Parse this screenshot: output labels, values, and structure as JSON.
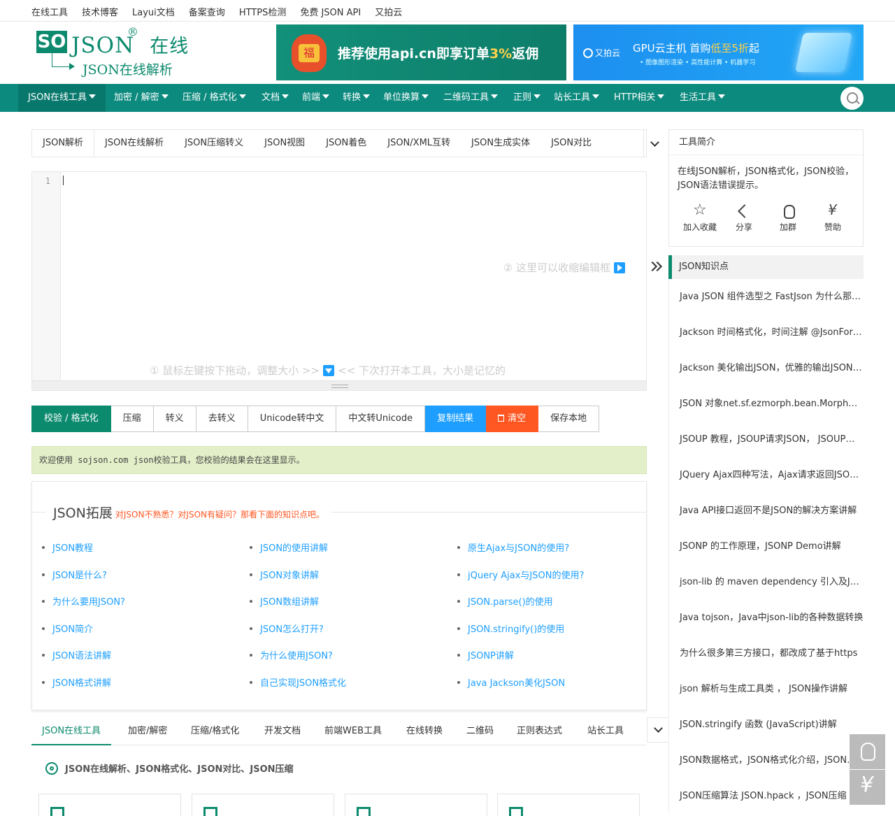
{
  "topbar": {
    "links": [
      "在线工具",
      "技术博客",
      "Layui文档",
      "备案查询",
      "HTTPS检测",
      "免费 JSON API",
      "又拍云"
    ]
  },
  "logo": {
    "so": "SO",
    "json": "JSON",
    "reg": "®",
    "zx": "在线",
    "sub": "JSON在线解析"
  },
  "ads": {
    "ad1": {
      "text_a": "推荐使用api.cn即享订单",
      "text_hl": "3%",
      "text_b": "返佣",
      "badge": "福"
    },
    "ad2": {
      "brand": "又拍云",
      "main_a": "GPU云主机 首购",
      "main_hl": "低至5折",
      "main_b": "起",
      "small": "• 图像图形渲染 • 高性能计算 • 机器学习"
    }
  },
  "nav": {
    "items": [
      "JSON在线工具",
      "加密 / 解密",
      "压缩 / 格式化",
      "文档",
      "前端",
      "转换",
      "单位换算",
      "二维码工具",
      "正则",
      "站长工具",
      "HTTP相关",
      "生活工具"
    ]
  },
  "tool_tabs": [
    "JSON解析",
    "JSON在线解析",
    "JSON压缩转义",
    "JSON视图",
    "JSON着色",
    "JSON/XML互转",
    "JSON生成实体",
    "JSON对比"
  ],
  "editor": {
    "line_number": "1",
    "hint_collapse": "② 这里可以收缩编辑框",
    "hint_resize_a": "① 鼠标左键按下拖动，调整大小 >>",
    "hint_resize_b": "<< 下次打开本工具，大小是记忆的"
  },
  "actions": [
    "校验 / 格式化",
    "压缩",
    "转义",
    "去转义",
    "Unicode转中文",
    "中文转Unicode",
    "复制结果",
    "清空",
    "保存本地"
  ],
  "result_text": "欢迎使用 sojson.com json校验工具，您校验的结果会在这里显示。",
  "extension": {
    "title": "JSON拓展",
    "subtitle": "对JSON不熟悉？对JSON有疑问？那看下面的知识点吧。",
    "col1": [
      "JSON教程",
      "JSON是什么?",
      "为什么要用JSON?",
      "JSON简介",
      "JSON语法讲解",
      "JSON格式讲解"
    ],
    "col2": [
      "JSON的使用讲解",
      "JSON对象讲解",
      "JSON数组讲解",
      "JSON怎么打开?",
      "为什么使用JSON?",
      "自己实现JSON格式化"
    ],
    "col3": [
      "原生Ajax与JSON的使用?",
      "jQuery Ajax与JSON的使用?",
      "JSON.parse()的使用",
      "JSON.stringify()的使用",
      "JSONP讲解",
      "Java Jackson美化JSON"
    ]
  },
  "bottom_tabs": [
    "JSON在线工具",
    "加密/解密",
    "压缩/格式化",
    "开发文档",
    "前端WEB工具",
    "在线转换",
    "二维码",
    "正则表达式",
    "站长工具"
  ],
  "section_title": "JSON在线解析、JSON格式化、JSON对比、JSON压缩",
  "sidebar": {
    "intro_title": "工具简介",
    "intro_desc": "在线JSON解析，JSON格式化，JSON校验，JSON语法错误提示。",
    "actions": [
      "加入收藏",
      "分享",
      "加群",
      "赞助"
    ],
    "kp_title": "JSON知识点",
    "kp_items": [
      "Java JSON 组件选型之 FastJson 为什么那么快",
      "Jackson 时间格式化，时间注解 @JsonFormat 用法",
      "Jackson 美化输出JSON，优雅的输出JSON数据",
      "JSON 对象net.sf.ezmorph.bean.MorphDynaBean",
      "JSOUP 教程，JSOUP请求JSON， JSOUP获取JSON",
      "JQuery Ajax四种写法，Ajax请求返回JSON数据",
      "Java API接口返回不是JSON的解决方案讲解",
      "JSONP 的工作原理，JSONP Demo讲解",
      "json-lib 的 maven dependency 引入及Jar包下载",
      "Java tojson，Java中json-lib的各种数据转换",
      "为什么很多第三方接口，都改成了基于https",
      "json 解析与生成工具类 ， JSON操作讲解",
      "JSON.stringify 函数 (JavaScript)讲解",
      "JSON数据格式，JSON格式化介绍，JSON校验",
      "JSON压缩算法 JSON.hpack ，JSON压缩"
    ]
  }
}
